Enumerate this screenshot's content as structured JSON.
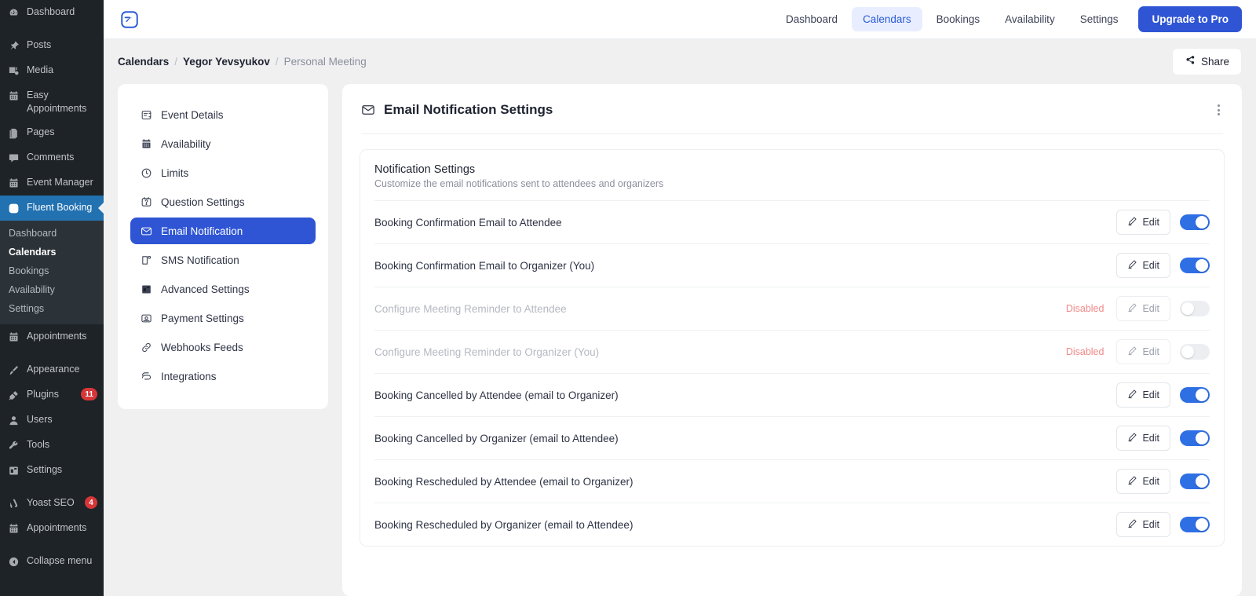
{
  "wp_admin": {
    "items": [
      {
        "label": "Dashboard",
        "icon": "dashboard-icon",
        "badge": null
      },
      {
        "label": "Posts",
        "icon": "pin-icon",
        "badge": null
      },
      {
        "label": "Media",
        "icon": "media-icon",
        "badge": null
      },
      {
        "label": "Easy Appointments",
        "icon": "calendar-icon",
        "badge": null
      },
      {
        "label": "Pages",
        "icon": "pages-icon",
        "badge": null
      },
      {
        "label": "Comments",
        "icon": "comment-icon",
        "badge": null
      },
      {
        "label": "Event Manager",
        "icon": "calendar-icon",
        "badge": null
      },
      {
        "label": "Fluent Booking",
        "icon": "fluent-booking-icon",
        "badge": null
      },
      {
        "label": "Appointments",
        "icon": "calendar-icon",
        "badge": null
      },
      {
        "label": "Appearance",
        "icon": "brush-icon",
        "badge": null
      },
      {
        "label": "Plugins",
        "icon": "plug-icon",
        "badge": "11"
      },
      {
        "label": "Users",
        "icon": "user-icon",
        "badge": null
      },
      {
        "label": "Tools",
        "icon": "wrench-icon",
        "badge": null
      },
      {
        "label": "Settings",
        "icon": "sliders-icon",
        "badge": null
      },
      {
        "label": "Yoast SEO",
        "icon": "yoast-icon",
        "badge": "4"
      },
      {
        "label": "Appointments",
        "icon": "calendar-icon",
        "badge": null
      },
      {
        "label": "Collapse menu",
        "icon": "collapse-icon",
        "badge": null
      }
    ],
    "active_label": "Fluent Booking",
    "submenu": [
      {
        "label": "Dashboard",
        "current": false
      },
      {
        "label": "Calendars",
        "current": true
      },
      {
        "label": "Bookings",
        "current": false
      },
      {
        "label": "Availability",
        "current": false
      },
      {
        "label": "Settings",
        "current": false
      }
    ]
  },
  "topbar": {
    "logo_name": "fluent-booking-logo",
    "nav": [
      {
        "label": "Dashboard",
        "selected": false
      },
      {
        "label": "Calendars",
        "selected": true
      },
      {
        "label": "Bookings",
        "selected": false
      },
      {
        "label": "Availability",
        "selected": false
      },
      {
        "label": "Settings",
        "selected": false
      }
    ],
    "upgrade_label": "Upgrade to Pro"
  },
  "breadcrumb": {
    "items": [
      "Calendars",
      "Yegor Yevsyukov",
      "Personal Meeting"
    ],
    "separator": "/",
    "share_label": "Share"
  },
  "left_nav": {
    "items": [
      {
        "label": "Event Details",
        "icon": "event-details-icon",
        "active": false
      },
      {
        "label": "Availability",
        "icon": "calendar-icon",
        "active": false
      },
      {
        "label": "Limits",
        "icon": "clock-icon",
        "active": false
      },
      {
        "label": "Question Settings",
        "icon": "question-icon",
        "active": false
      },
      {
        "label": "Email Notification",
        "icon": "envelope-icon",
        "active": true
      },
      {
        "label": "SMS Notification",
        "icon": "sms-icon",
        "active": false
      },
      {
        "label": "Advanced Settings",
        "icon": "sliders-icon",
        "active": false
      },
      {
        "label": "Payment Settings",
        "icon": "payment-icon",
        "active": false
      },
      {
        "label": "Webhooks Feeds",
        "icon": "link-icon",
        "active": false
      },
      {
        "label": "Integrations",
        "icon": "integrations-icon",
        "active": false
      }
    ]
  },
  "panel": {
    "icon": "envelope-icon",
    "title": "Email Notification Settings",
    "menu_icon": "kebab-menu-icon",
    "section": {
      "title": "Notification Settings",
      "description": "Customize the email notifications sent to attendees and organizers"
    },
    "edit_label": "Edit",
    "disabled_label": "Disabled",
    "rows": [
      {
        "label": "Booking Confirmation Email to Attendee",
        "enabled": true,
        "status": ""
      },
      {
        "label": "Booking Confirmation Email to Organizer (You)",
        "enabled": true,
        "status": ""
      },
      {
        "label": "Configure Meeting Reminder to Attendee",
        "enabled": false,
        "status": "Disabled"
      },
      {
        "label": "Configure Meeting Reminder to Organizer (You)",
        "enabled": false,
        "status": "Disabled"
      },
      {
        "label": "Booking Cancelled by Attendee (email to Organizer)",
        "enabled": true,
        "status": ""
      },
      {
        "label": "Booking Cancelled by Organizer (email to Attendee)",
        "enabled": true,
        "status": ""
      },
      {
        "label": "Booking Rescheduled by Attendee (email to Organizer)",
        "enabled": true,
        "status": ""
      },
      {
        "label": "Booking Rescheduled by Organizer (email to Attendee)",
        "enabled": true,
        "status": ""
      }
    ]
  },
  "colors": {
    "accent": "#2f55d4",
    "toggle_on": "#2f6fe4",
    "wp_active": "#2271b1",
    "disabled_text": "#f08a8a",
    "page_bg": "#f0f0f1"
  }
}
